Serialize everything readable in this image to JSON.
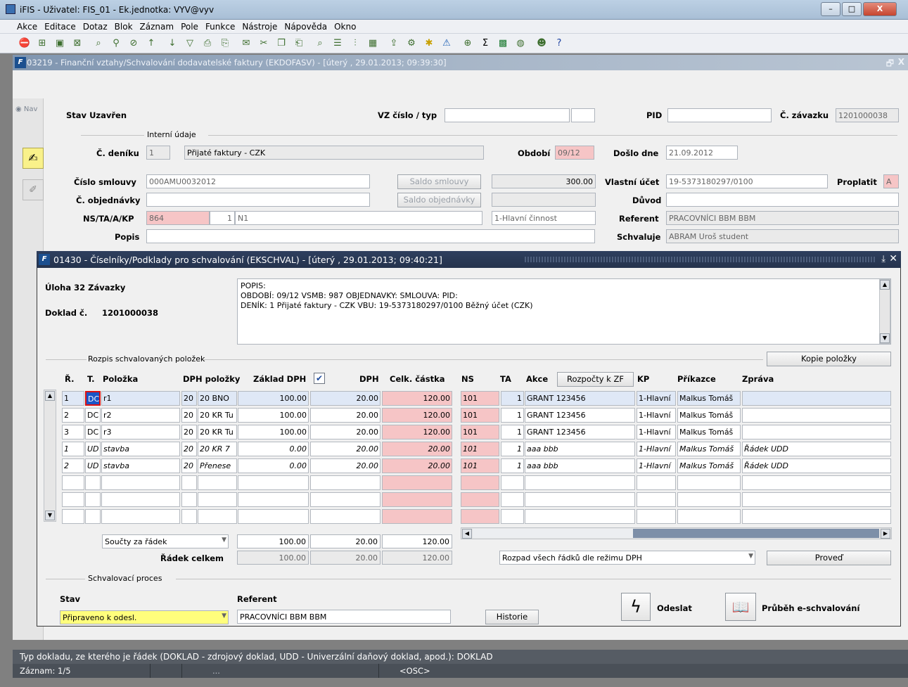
{
  "window": {
    "title": "iFIS - Uživatel: FIS_01 - Ek.jednotka: VYV@vyv",
    "min": "–",
    "max": "□",
    "close": "X"
  },
  "menu": [
    "Akce",
    "Editace",
    "Dotaz",
    "Blok",
    "Záznam",
    "Pole",
    "Funkce",
    "Nástroje",
    "Nápověda",
    "Okno"
  ],
  "toolbar_icons": [
    "exit-icon",
    "insert-record-icon",
    "save-icon",
    "delete-record-icon",
    "query-icon",
    "execute-query-icon",
    "cancel-query-icon",
    "sort-asc-icon",
    "sort-desc-icon",
    "filter-icon",
    "print-icon",
    "print-preview-icon",
    "mail-icon",
    "cut-icon",
    "copy-icon",
    "paste-icon",
    "search-icon",
    "list-icon",
    "tree-icon",
    "calendar-icon",
    "export-icon",
    "settings-icon",
    "star-icon",
    "warning-icon",
    "calculator-icon",
    "sum-icon",
    "excel-icon",
    "globe-icon",
    "users-icon",
    "help-icon"
  ],
  "form": {
    "title": "03219 - Finanční vztahy/Schvalování dodavatelské faktury (EKDOFASV) - [úterý , 29.01.2013; 09:39:30]",
    "nav": "Nav",
    "restore": "🗗",
    "close": "X",
    "stav_label": "Stav",
    "stav_value": "Uzavřen",
    "vz_label": "VZ číslo / typ",
    "vz_value": "",
    "pid_label": "PID",
    "pid_value": "",
    "zavazek_label": "Č. závazku",
    "zavazek_value": "1201000038",
    "interni_label": "Interní údaje",
    "denik_label": "Č. deníku",
    "denik_value": "1",
    "denik_name": "Přijaté faktury - CZK",
    "obdobi_label": "Období",
    "obdobi_value": "09/12",
    "doslo_label": "Došlo dne",
    "doslo_value": "21.09.2012",
    "smlouva_label": "Číslo smlouvy",
    "smlouva_value": "000AMU0032012",
    "saldo_smlouvy": "Saldo smlouvy",
    "saldo_smlouvy_value": "300.00",
    "vlastni_label": "Vlastní účet",
    "vlastni_value": "19-5373180297/0100",
    "proplatit_label": "Proplatit",
    "proplatit_value": "A",
    "objednavka_label": "Č. objednávky",
    "objednavka_value": "",
    "saldo_obj": "Saldo objednávky",
    "saldo_obj_value": "",
    "duvod_label": "Důvod",
    "duvod_value": "",
    "ns_label": "NS/TA/A/KP",
    "ns_value": "864",
    "ta_value": "1",
    "a_value": "N1",
    "kp_value": "1-Hlavní činnost",
    "referent_label": "Referent",
    "referent_value": "PRACOVNÍCI BBM BBM",
    "popis_label": "Popis",
    "popis_value": "",
    "schvaluje_label": "Schvaluje",
    "schvaluje_value": "ABRAM Uroš student"
  },
  "dialog": {
    "title": "01430 - Číselníky/Podklady pro schvalování (EKSCHVAL) - [úterý , 29.01.2013; 09:40:21]",
    "uloha": "Úloha 32 Závazky",
    "doklad_label": "Doklad č.",
    "doklad_value": "1201000038",
    "popis_lines": [
      "POPIS:",
      "OBDOBÍ: 09/12 VSMB: 987 OBJEDNAVKY:  SMLOUVA:  PID:",
      "DENÍK: 1 Přijaté faktury - CZK VBU: 19-5373180297/0100 Běžný účet (CZK)"
    ],
    "rozpis_label": "Rozpis schvalovaných položek",
    "kopie_button": "Kopie položky",
    "columns": {
      "r": "Ř.",
      "t": "T.",
      "polozka": "Položka",
      "dph_pol": "DPH položky",
      "zaklad": "Základ DPH",
      "check": "✔",
      "dph": "DPH",
      "celk": "Celk. částka",
      "ns": "NS",
      "ta": "TA",
      "akce": "Akce",
      "rozpocty": "Rozpočty k ZF",
      "kp": "KP",
      "prikazce": "Příkazce",
      "zprava": "Zpráva"
    },
    "rows": [
      {
        "r": "1",
        "t": "DC",
        "pol": "r1",
        "dp1": "20",
        "dp2": "20 BNO",
        "zak": "100.00",
        "dph": "20.00",
        "celk": "120.00",
        "ns": "101",
        "ta": "1",
        "akce": "GRANT 123456",
        "kp": "1-Hlavní",
        "prik": "Malkus Tomáš",
        "zpr": ""
      },
      {
        "r": "2",
        "t": "DC",
        "pol": "r2",
        "dp1": "20",
        "dp2": "20 KR Tu",
        "zak": "100.00",
        "dph": "20.00",
        "celk": "120.00",
        "ns": "101",
        "ta": "1",
        "akce": "GRANT 123456",
        "kp": "1-Hlavní",
        "prik": "Malkus Tomáš",
        "zpr": ""
      },
      {
        "r": "3",
        "t": "DC",
        "pol": "r3",
        "dp1": "20",
        "dp2": "20 KR Tu",
        "zak": "100.00",
        "dph": "20.00",
        "celk": "120.00",
        "ns": "101",
        "ta": "1",
        "akce": "GRANT 123456",
        "kp": "1-Hlavní",
        "prik": "Malkus Tomáš",
        "zpr": ""
      },
      {
        "r": "1",
        "t": "UD",
        "pol": "stavba",
        "dp1": "20",
        "dp2": "20 KR 7",
        "zak": "0.00",
        "dph": "20.00",
        "celk": "20.00",
        "ns": "101",
        "ta": "1",
        "akce": "aaa bbb",
        "kp": "1-Hlavní",
        "prik": "Malkus Tomáš",
        "zpr": "Řádek UDD"
      },
      {
        "r": "2",
        "t": "UD",
        "pol": "stavba",
        "dp1": "20",
        "dp2": "Přenese",
        "zak": "0.00",
        "dph": "20.00",
        "celk": "20.00",
        "ns": "101",
        "ta": "1",
        "akce": "aaa bbb",
        "kp": "1-Hlavní",
        "prik": "Malkus Tomáš",
        "zpr": "Řádek UDD"
      }
    ],
    "soucty_select": "Součty za řádek",
    "sum_zaklad": "100.00",
    "sum_dph": "20.00",
    "sum_celk": "120.00",
    "radek_celkem_label": "Řádek celkem",
    "rc_zaklad": "100.00",
    "rc_dph": "20.00",
    "rc_celk": "120.00",
    "rozpad_select": "Rozpad všech řádků dle režimu DPH",
    "proved_button": "Proveď",
    "schv_label": "Schvalovací proces",
    "stav_label": "Stav",
    "stav_value": "Připraveno k odesl.",
    "referent_label": "Referent",
    "referent_value": "PRACOVNÍCI BBM BBM",
    "historie_button": "Historie",
    "odeslat_button": "Odeslat",
    "prubeh_button": "Průběh e-schvalování"
  },
  "status": {
    "hint": "Typ dokladu, ze kterého je řádek (DOKLAD - zdrojový doklad, UDD - Univerzální daňový doklad, apod.): DOKLAD",
    "zaznam": "Záznam: 1/5",
    "dots": "...",
    "osc": "<OSC>"
  },
  "colors": {
    "pink": "#f6c5c6",
    "yellow": "#fffe7c",
    "dialog_title": "#25334d"
  }
}
